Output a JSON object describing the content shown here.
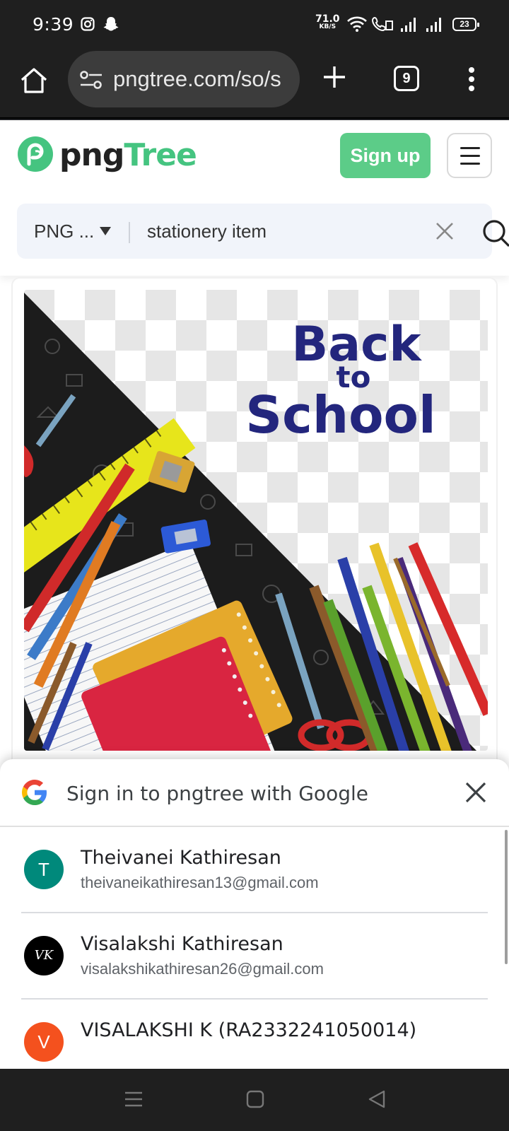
{
  "status_bar": {
    "time": "9:39",
    "net_speed_value": "71.0",
    "net_speed_unit": "KB/S",
    "battery": "23",
    "icons": [
      "instagram-icon",
      "snapchat-icon",
      "wifi-icon",
      "volte-call-icon",
      "signal-icon",
      "signal-icon",
      "battery-icon"
    ]
  },
  "browser": {
    "url": "pngtree.com/so/s",
    "tab_count": "9"
  },
  "site": {
    "logo_dark": "png",
    "logo_green": "Tree",
    "signup_label": "Sign up",
    "brand_color": "#5ccc88",
    "search": {
      "type_label": "PNG ...",
      "query": "stationery item"
    }
  },
  "artwork": {
    "line1": "Back",
    "line2": "to",
    "line3": "School",
    "text_color": "#23267d"
  },
  "google_signin": {
    "title": "Sign in to pngtree with Google",
    "accounts": [
      {
        "initial": "T",
        "name": "Theivanei Kathiresan",
        "email": "theivaneikathiresan13@gmail.com",
        "avatar_color": "#00897b"
      },
      {
        "initial": "VK",
        "name": "Visalakshi Kathiresan",
        "email": "visalakshikathiresan26@gmail.com",
        "avatar_color": "#000000"
      },
      {
        "initial": "V",
        "name": "VISALAKSHI K (RA2332241050014)",
        "email": "",
        "avatar_color": "#f4511e"
      }
    ]
  }
}
